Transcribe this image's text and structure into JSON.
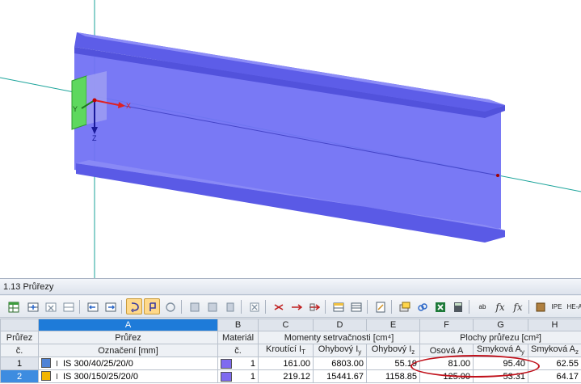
{
  "viewport": {
    "axis_x_label": "X",
    "axis_y_label": "Y",
    "axis_z_label": "Z"
  },
  "panel": {
    "title": "1.13 Průřezy"
  },
  "toolbar": {
    "icons": [
      "table-edit-icon",
      "insert-row-icon",
      "delete-row-icon",
      "sort-icon",
      "import-icon",
      "export-icon",
      "select-icon",
      "pick-icon",
      "refresh-icon",
      "graphics-icon",
      "view-icon",
      "filter-icon",
      "clear-icon",
      "cut-icon",
      "copy-row-icon",
      "paste-row-icon",
      "columns-icon",
      "rows-icon",
      "notes-icon",
      "settings-icon",
      "excel-link-icon",
      "excel-icon",
      "calculator-icon",
      "number-format-icon",
      "formula-icon",
      "formula-clear-icon",
      "library-icon",
      "ipe-icon",
      "hea-icon"
    ],
    "active": [
      "select-icon",
      "pick-icon"
    ],
    "ab_label": "ab",
    "fx_label": "fx",
    "fx2_label": "fx",
    "ipe_label": "IPE",
    "hea_label": "HE-A"
  },
  "table": {
    "col_letters": [
      "A",
      "B",
      "C",
      "D",
      "E",
      "F",
      "G",
      "H"
    ],
    "selected_col": "A",
    "h1": {
      "prurez_c": "Průřez",
      "prurez": "Průřez",
      "material": "Materiál",
      "momenty": "Momenty setrvačnosti [cm⁴]",
      "plochy": "Plochy průřezu [cm²]"
    },
    "h2": {
      "prurez_c": "č.",
      "oznaceni": "Označení [mm]",
      "material": "č.",
      "kroutici": "Kroutící I",
      "kroutici_sub": "T",
      "ohybovy_y": "Ohybový I",
      "ohybovy_y_sub": "y",
      "ohybovy_z": "Ohybový I",
      "ohybovy_z_sub": "z",
      "osova": "Osová A",
      "smykova_y": "Smyková A",
      "smykova_y_sub": "y",
      "smykova_z": "Smyková A",
      "smykova_z_sub": "z"
    },
    "rows": [
      {
        "no": "1",
        "color": "#4f83d6",
        "name": "IS 300/40/25/20/0",
        "material": "1",
        "it": "161.00",
        "iy": "6803.00",
        "iz": "55.19",
        "a": "81.00",
        "ay": "95.40",
        "az": "62.55"
      },
      {
        "no": "2",
        "color": "#f2b500",
        "name": "IS 300/150/25/20/0",
        "material": "1",
        "it": "219.12",
        "iy": "15441.67",
        "iz": "1158.85",
        "a": "125.00",
        "ay": "53.31",
        "az": "64.17"
      }
    ]
  },
  "colors": {
    "beam": "#6c6cf2",
    "accent": "#1e7bd9",
    "highlight_circle": "#c0101a",
    "axis_line": "#1aa39a"
  }
}
